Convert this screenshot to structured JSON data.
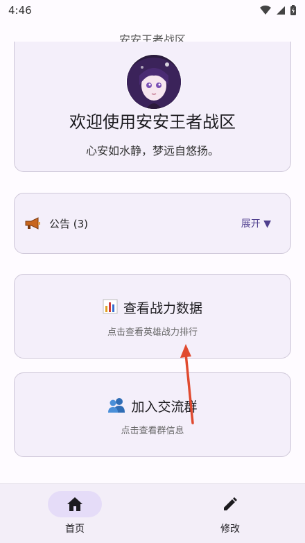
{
  "status_bar": {
    "time": "4:46"
  },
  "app_title": "安安王者战区",
  "welcome": {
    "title": "欢迎使用安安王者战区",
    "subtitle": "心安如水静，梦远自悠扬。"
  },
  "notice": {
    "label": "公告 (3)",
    "expand_label": "展开 ▼",
    "icon": "megaphone-icon"
  },
  "features": [
    {
      "title": "查看战力数据",
      "subtitle": "点击查看英雄战力排行",
      "icon": "bar-chart-icon"
    },
    {
      "title": "加入交流群",
      "subtitle": "点击查看群信息",
      "icon": "group-icon"
    }
  ],
  "bottom_nav": {
    "items": [
      {
        "label": "首页",
        "icon": "home-icon",
        "active": true
      },
      {
        "label": "修改",
        "icon": "edit-pencil-icon",
        "active": false
      }
    ]
  },
  "colors": {
    "accent": "#4f3f8e",
    "card_bg": "#f4effa",
    "annotation_arrow": "#e04a2f"
  }
}
